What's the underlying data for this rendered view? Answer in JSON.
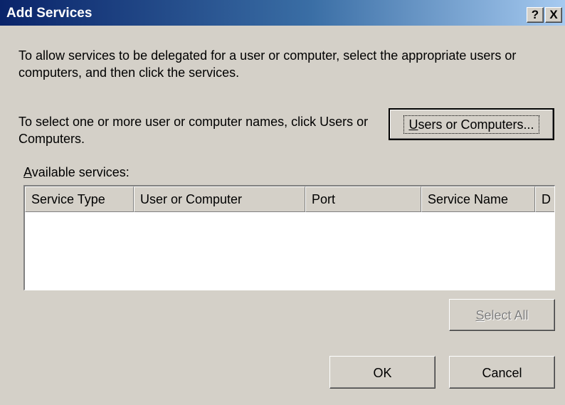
{
  "window": {
    "title": "Add Services",
    "help_label": "?",
    "close_label": "X"
  },
  "intro_text": "To allow services to be delegated for a user or computer, select the appropriate users or computers, and then click the services.",
  "picker": {
    "hint_text": "To select one or more user or computer names, click Users or Computers.",
    "button_mnemonic": "U",
    "button_rest": "sers or Computers..."
  },
  "available_services": {
    "label_mnemonic": "A",
    "label_rest": "vailable services:",
    "columns": [
      "Service Type",
      "User or Computer",
      "Port",
      "Service Name",
      "D"
    ],
    "rows": []
  },
  "buttons": {
    "select_all_mnemonic": "S",
    "select_all_rest": "elect All",
    "ok": "OK",
    "cancel": "Cancel"
  }
}
